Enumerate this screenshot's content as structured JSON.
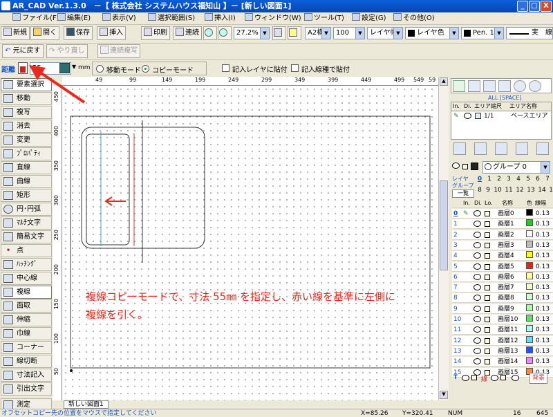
{
  "window": {
    "title": "AR_CAD Ver.1.3.0　－【 株式会社 システムハウス福知山 】－ [新しい図面1]",
    "minimize": "_",
    "maximize": "□",
    "close": "X"
  },
  "menu": [
    "ファイル(F)",
    "編集(E)",
    "表示(V)",
    "選択範囲(S)",
    "挿入(I)",
    "ウィンドウ(W)",
    "ツール(T)",
    "設定(G)",
    "その他(O)"
  ],
  "toolbar": {
    "new": "新規",
    "open": "開く",
    "save": "保存",
    "insert": "挿入",
    "print": "印刷",
    "continuous": "連続",
    "zoom": "27.2%",
    "paper": "A2横",
    "scale": "100",
    "layer_width": "レイヤ幅",
    "layer_color": "レイヤ色",
    "pen": "Pen. 1",
    "linetype": "実　線"
  },
  "toolbar2": {
    "undo": "元に戻す",
    "redo": "やり直し",
    "continuous_copy": "連続複写"
  },
  "options": {
    "distance_label": "距離",
    "distance_value": "55",
    "unit": "mm",
    "move_mode": "移動モード",
    "copy_mode": "コピーモード",
    "paste_layer": "記入レイヤに貼付",
    "paste_linetype": "記入線種で貼付"
  },
  "tools": [
    "要素選択",
    "移動",
    "複写",
    "消去",
    "変更",
    "ﾌﾟﾛﾊﾟﾃｨ",
    "直線",
    "曲線",
    "矩形",
    "円･円弧",
    "ﾏﾙﾁ文字",
    "簡易文字",
    "点",
    "ﾊｯﾁﾝｸﾞ",
    "中心線",
    "複線",
    "面取",
    "伸縮",
    "巾線",
    "コーナー",
    "線切断",
    "寸法記入",
    "引出文字",
    "測定"
  ],
  "ruler": {
    "top": [
      "49",
      "99",
      "149",
      "199",
      "249",
      "299",
      "349",
      "399",
      "449",
      "499",
      "549",
      "59"
    ],
    "left": [
      "450",
      "400",
      "350",
      "300",
      "250",
      "200",
      "150",
      "100",
      "50"
    ]
  },
  "annotation": {
    "line1": "複線コピーモードで、寸法 55㎜ を指定し、赤い線を基準に左側に",
    "line2": "複線を引く。"
  },
  "doc_tab": "新しい図面1",
  "status": {
    "hint": "オフセットコピー先の位置をマウスで指定してください",
    "x": "X=85.26",
    "y": "Y=320.41",
    "num": "NUM",
    "page": "16",
    "zoom": "645"
  },
  "area": {
    "all_label": "ALL [SPACE]",
    "headers": [
      "In.",
      "Di.",
      "エリア縮尺",
      "エリア名称"
    ],
    "row_scale": "1/1",
    "row_name": "ベースエリア"
  },
  "group": {
    "label": "グループ 0",
    "layer_group_label": "レイヤ グループ",
    "list_button": "一覧",
    "numbers_row1": [
      "0",
      "1",
      "2",
      "3",
      "4",
      "5",
      "6",
      "7"
    ],
    "numbers_row2": [
      "8",
      "9",
      "10",
      "11",
      "12",
      "13",
      "14",
      "15"
    ]
  },
  "layers": {
    "headers": [
      "In.",
      "Di.",
      "Lo.",
      "名称",
      "色",
      "線幅"
    ],
    "rows": [
      {
        "num": "0",
        "name": "画層0",
        "color": "#000000",
        "width": "0.13"
      },
      {
        "num": "1",
        "name": "画層1",
        "color": "#22cc22",
        "width": "0.13"
      },
      {
        "num": "2",
        "name": "画層2",
        "color": "#ffffff",
        "width": "0.13"
      },
      {
        "num": "3",
        "name": "画層3",
        "color": "#bdbdbd",
        "width": "0.13"
      },
      {
        "num": "4",
        "name": "画層4",
        "color": "#ffff00",
        "width": "0.13"
      },
      {
        "num": "5",
        "name": "画層5",
        "color": "#ff1a1a",
        "width": "0.13"
      },
      {
        "num": "6",
        "name": "画層6",
        "color": "#ffff99",
        "width": "0.13"
      },
      {
        "num": "7",
        "name": "画層7",
        "color": "#eeffcc",
        "width": "0.13"
      },
      {
        "num": "8",
        "name": "画層8",
        "color": "#ccffcc",
        "width": "0.13"
      },
      {
        "num": "9",
        "name": "画層9",
        "color": "#aaffaa",
        "width": "0.13"
      },
      {
        "num": "10",
        "name": "画層10",
        "color": "#66dd66",
        "width": "0.13"
      },
      {
        "num": "11",
        "name": "画層11",
        "color": "#aaffee",
        "width": "0.13"
      },
      {
        "num": "12",
        "name": "画層12",
        "color": "#66ddff",
        "width": "0.13"
      },
      {
        "num": "13",
        "name": "画層13",
        "color": "#2255ff",
        "width": "0.13"
      },
      {
        "num": "14",
        "name": "画層14",
        "color": "#ee88ff",
        "width": "0.13"
      },
      {
        "num": "15",
        "name": "画層15",
        "color": "#ff8844",
        "width": "0.13"
      }
    ],
    "footer_label": "線",
    "footer_button": "背景"
  },
  "colors": {
    "highlight": "#e8291c",
    "blue_line": "#3aa5c9",
    "title_bar": "#0a5fd8"
  }
}
